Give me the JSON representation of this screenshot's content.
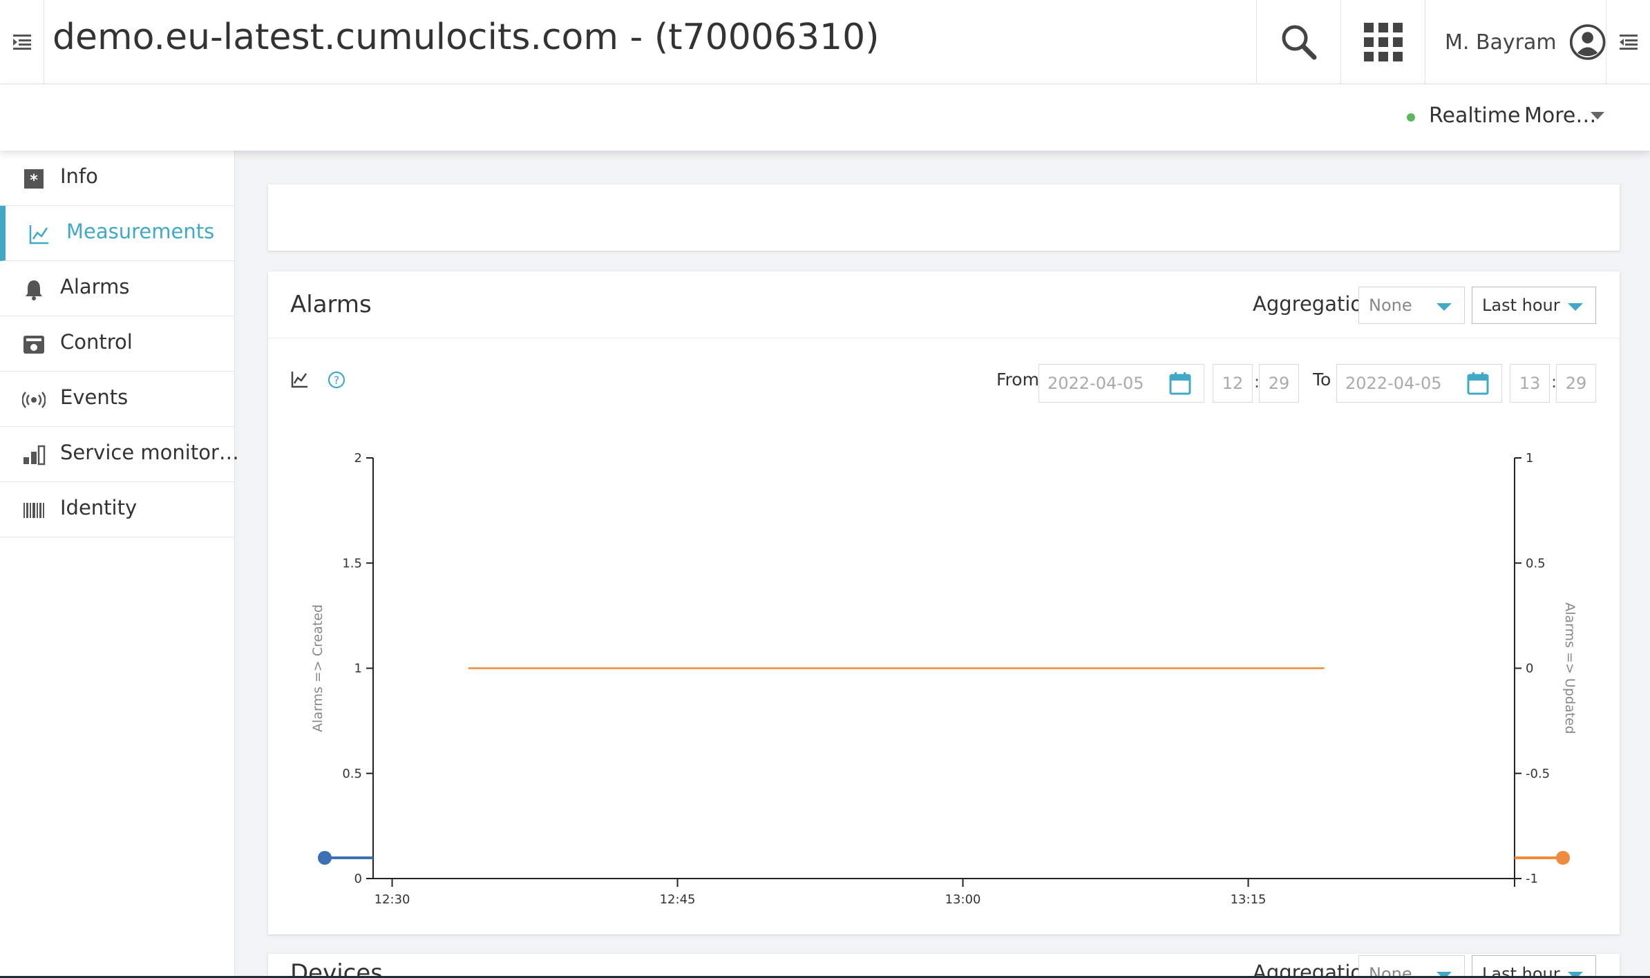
{
  "header": {
    "title": "demo.eu-latest.cumulocits.com - (t70006310)",
    "user_name": "M. Bayram"
  },
  "subheader": {
    "realtime_label": "Realtime",
    "more_label": "More…",
    "realtime_color": "#5cb85c"
  },
  "sidebar": {
    "items": [
      {
        "label": "Info",
        "icon": "info-icon"
      },
      {
        "label": "Measurements",
        "icon": "line-chart-icon",
        "active": true
      },
      {
        "label": "Alarms",
        "icon": "bell-icon"
      },
      {
        "label": "Control",
        "icon": "control-icon"
      },
      {
        "label": "Events",
        "icon": "broadcast-icon"
      },
      {
        "label": "Service monitor…",
        "icon": "bar-chart-icon"
      },
      {
        "label": "Identity",
        "icon": "barcode-icon"
      }
    ]
  },
  "alarms_card": {
    "title": "Alarms",
    "aggregation_label": "Aggregation",
    "aggregation_value": "None",
    "range_value": "Last hour",
    "from_label": "From",
    "from_date": "2022-04-05",
    "from_hour": "12",
    "from_minute": "29",
    "to_label": "To",
    "to_date": "2022-04-05",
    "to_hour": "13",
    "to_minute": "29",
    "accent_color": "#3fa9c7"
  },
  "devices_card": {
    "title": "Devices",
    "aggregation_label": "Aggregation",
    "aggregation_value": "None",
    "range_value": "Last hour"
  },
  "chart_data": {
    "type": "line",
    "x_ticks": [
      "12:30",
      "12:45",
      "13:00",
      "13:15"
    ],
    "x_range": [
      "12:29",
      "13:29"
    ],
    "left_axis": {
      "label": "Alarms => Created",
      "ylim": [
        0,
        2
      ],
      "ticks": [
        "0",
        "0.5",
        "1",
        "1.5",
        "2"
      ]
    },
    "right_axis": {
      "label": "Alarms => Updated",
      "ylim": [
        -1,
        1
      ],
      "ticks": [
        "-1",
        "-0.5",
        "0",
        "0.5",
        "1"
      ]
    },
    "series": [
      {
        "axis": "left",
        "color": "#3b6fb6",
        "points": []
      },
      {
        "axis": "left",
        "color": "#f08a3c",
        "x": [
          "12:34",
          "13:19"
        ],
        "y": [
          1,
          1
        ]
      }
    ],
    "grid": false
  }
}
